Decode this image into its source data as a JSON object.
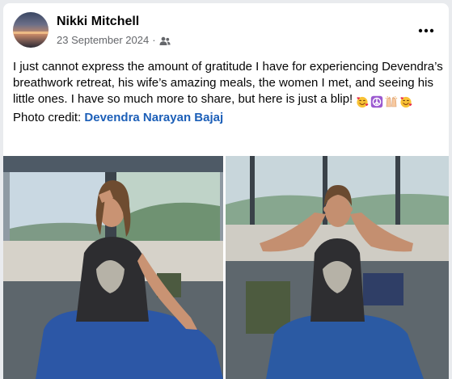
{
  "post": {
    "author": "Nikki Mitchell",
    "date": "23 September 2024",
    "separator": "·",
    "audience_icon": "friends-icon",
    "more_icon": "more-horizontal-icon",
    "text": "I just cannot express the amount of gratitude I have for experiencing Devendra’s breathwork retreat, his wife’s amazing meals, the women I met, and seeing his little ones. I have so much more to share, but here is just a blip!",
    "emojis": [
      "smiling-face-with-hearts",
      "peace-symbol",
      "raising-hands",
      "smiling-face-with-hearts"
    ],
    "credit_label": "Photo credit: ",
    "credit_name": "Devendra Narayan Bajaj"
  },
  "colors": {
    "name_text": "#050505",
    "secondary_text": "#65676b",
    "link": "#1c5fb8",
    "peace_emoji_bg": "#9b59d0"
  },
  "photos": [
    {
      "subject": "woman-meditating-hand-on-forehead"
    },
    {
      "subject": "woman-meditating-fingers-on-eyes"
    }
  ]
}
